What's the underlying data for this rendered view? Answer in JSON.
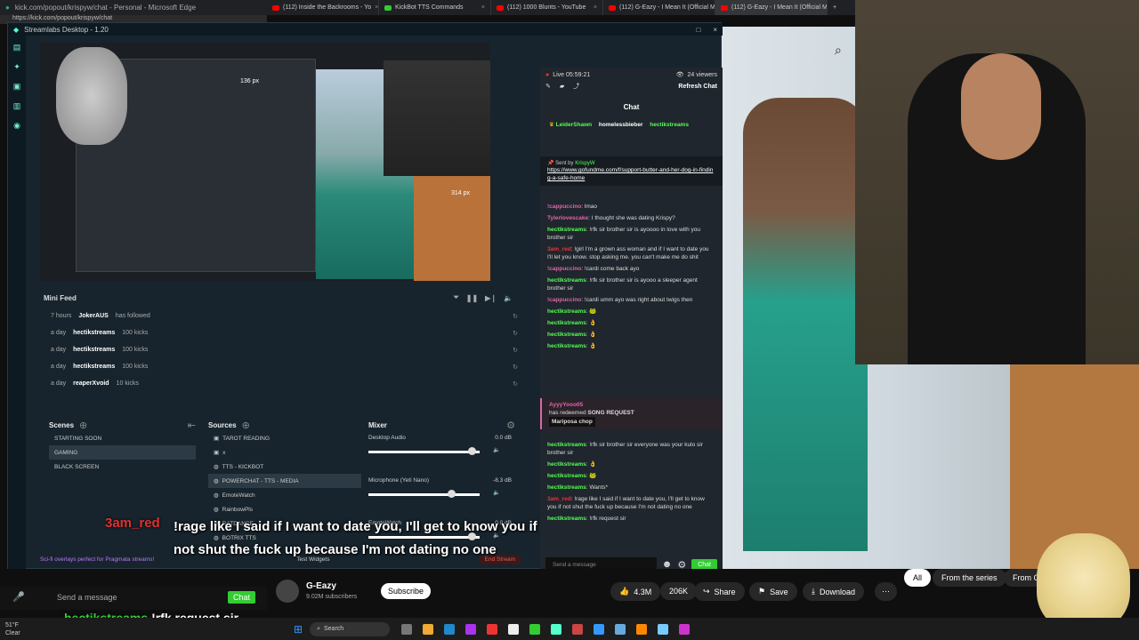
{
  "browser": {
    "window_title": "kick.com/popout/krispyw/chat - Personal - Microsoft Edge",
    "url": "https://kick.com/popout/krispyw/chat",
    "tabs": [
      {
        "label": "(112) Inside the Backrooms - Yo"
      },
      {
        "label": "KickBot TTS Commands"
      },
      {
        "label": "(112) 1000 Blunts - YouTube"
      },
      {
        "label": "(112) G-Eazy - I Mean It (Official M"
      },
      {
        "label": "(112) G-Eazy - I Mean It (Official M"
      }
    ]
  },
  "streamlabs": {
    "title": "Streamlabs Desktop - 1.20",
    "preview": {
      "dim_w": "136 px",
      "dim_h": "314 px"
    },
    "mini_feed": {
      "title": "Mini Feed",
      "rows": [
        {
          "time": "7 hours",
          "user": "JokerAUS",
          "event": "has followed"
        },
        {
          "time": "a day",
          "user": "hectikstreams",
          "event": "100 kicks"
        },
        {
          "time": "a day",
          "user": "hectikstreams",
          "event": "100 kicks"
        },
        {
          "time": "a day",
          "user": "hectikstreams",
          "event": "100 kicks"
        },
        {
          "time": "a day",
          "user": "reaperXvoid",
          "event": "10 kicks"
        }
      ]
    },
    "scenes": {
      "title": "Scenes",
      "items": [
        {
          "label": "STARTING SOON"
        },
        {
          "label": "GAMING"
        },
        {
          "label": "BLACK SCREEN"
        }
      ]
    },
    "sources": {
      "title": "Sources",
      "items": [
        {
          "label": "TAROT READING"
        },
        {
          "label": "x"
        },
        {
          "label": "TTS - KICKBOT"
        },
        {
          "label": "POWERCHAT - TTS - MEDIA"
        },
        {
          "label": "EmoteWatch"
        },
        {
          "label": "RainbowPls"
        },
        {
          "label": "RATDANCE"
        },
        {
          "label": "BOTRIX TTS"
        }
      ]
    },
    "mixer": {
      "title": "Mixer",
      "channels": [
        {
          "name": "Desktop Audio",
          "db": "0.0 dB",
          "level": 0.93
        },
        {
          "name": "Microphone (Yeti Nano)",
          "db": "-8.3 dB",
          "level": 0.74
        },
        {
          "name": "EmoteWatch",
          "db": "0.0 dB",
          "level": 0.93
        }
      ]
    },
    "footer": {
      "promo": "Sci-fi overlays perfect for Pragmata streams!",
      "test_widgets": "Test Widgets",
      "end_stream": "End Stream"
    }
  },
  "chat": {
    "live_time": "Live 05:59:21",
    "viewers": "24 viewers",
    "refresh": "Refresh Chat",
    "title": "Chat",
    "top_users": [
      "LeiderShawn",
      "homelessbieber",
      "hectikstreams"
    ],
    "pinned": {
      "sent_by": "Sent by",
      "user": "KrispyW",
      "link": "https://www.gofundme.com/f/support-butter-and-her-dog-in-finding-a-safe-home"
    },
    "messages": [
      {
        "user": "!cappuccino",
        "text": "lmao",
        "color": "pink"
      },
      {
        "user": "Tylerlovescake",
        "text": "I thought she was dating Krispy?",
        "color": "pink"
      },
      {
        "user": "hectikstreams",
        "text": "!rfk sir brother sir is ayoooo in love with you brother sir",
        "color": "green"
      },
      {
        "user": "3am_red",
        "text": "!girl I'm a grown ass woman and if I want to date you I'll let you know. stop asking me. you can't make me do shit",
        "color": "red"
      },
      {
        "user": "!cappuccino",
        "text": "!cardi come back ayo",
        "color": "pink"
      },
      {
        "user": "hectikstreams",
        "text": "!rfk sir brother sir is ayooo a sleeper agent brother sir",
        "color": "green"
      },
      {
        "user": "!cappuccino",
        "text": "!cardi umm ayo was right about twigs then",
        "color": "pink"
      },
      {
        "user": "hectikstreams",
        "text": "",
        "color": "green"
      },
      {
        "user": "hectikstreams",
        "text": "",
        "color": "green"
      },
      {
        "user": "hectikstreams",
        "text": "",
        "color": "green"
      },
      {
        "user": "hectikstreams",
        "text": "",
        "color": "green"
      }
    ],
    "redeem": {
      "user": "AyyyYooo05",
      "text": "has redeemed",
      "reward": "SONG REQUEST",
      "value": "Mariposa chop"
    },
    "messages2": [
      {
        "user": "hectikstreams",
        "text": "!rfk sir brother sir everyone was your kulo sir brother sir",
        "color": "green"
      },
      {
        "user": "hectikstreams",
        "text": "",
        "color": "green"
      },
      {
        "user": "hectikstreams",
        "text": "",
        "color": "green"
      },
      {
        "user": "hectikstreams",
        "text": "Wants*",
        "color": "green"
      },
      {
        "user": "3am_red",
        "text": "!rage like I said if I want to date you, I'll get to know you if not shut the fuck up because I'm not dating no one",
        "color": "red"
      },
      {
        "user": "hectikstreams",
        "text": "!rfk request sir",
        "color": "green"
      }
    ],
    "input_placeholder": "Send a message",
    "chat_button": "Chat"
  },
  "youtube": {
    "channel": "G-Eazy",
    "subscribers": "9.02M subscribers",
    "subscribe": "Subscribe",
    "likes": "4.3M",
    "comments_count": "206K",
    "share": "Share",
    "save": "Save",
    "download": "Download",
    "chips": [
      "All",
      "From the series",
      "From G"
    ]
  },
  "overlay": {
    "name": "3am_red",
    "text": "!rage like I said if I want to date you, I'll get to know you if not shut the fuck up because I'm not dating no one",
    "name2": "hectikstreams",
    "text2": "!rfk request sir",
    "mini_input": "Send a message",
    "mini_chat": "Chat"
  },
  "taskbar": {
    "weather_temp": "51°F",
    "weather": "Clear",
    "search": "Search"
  }
}
